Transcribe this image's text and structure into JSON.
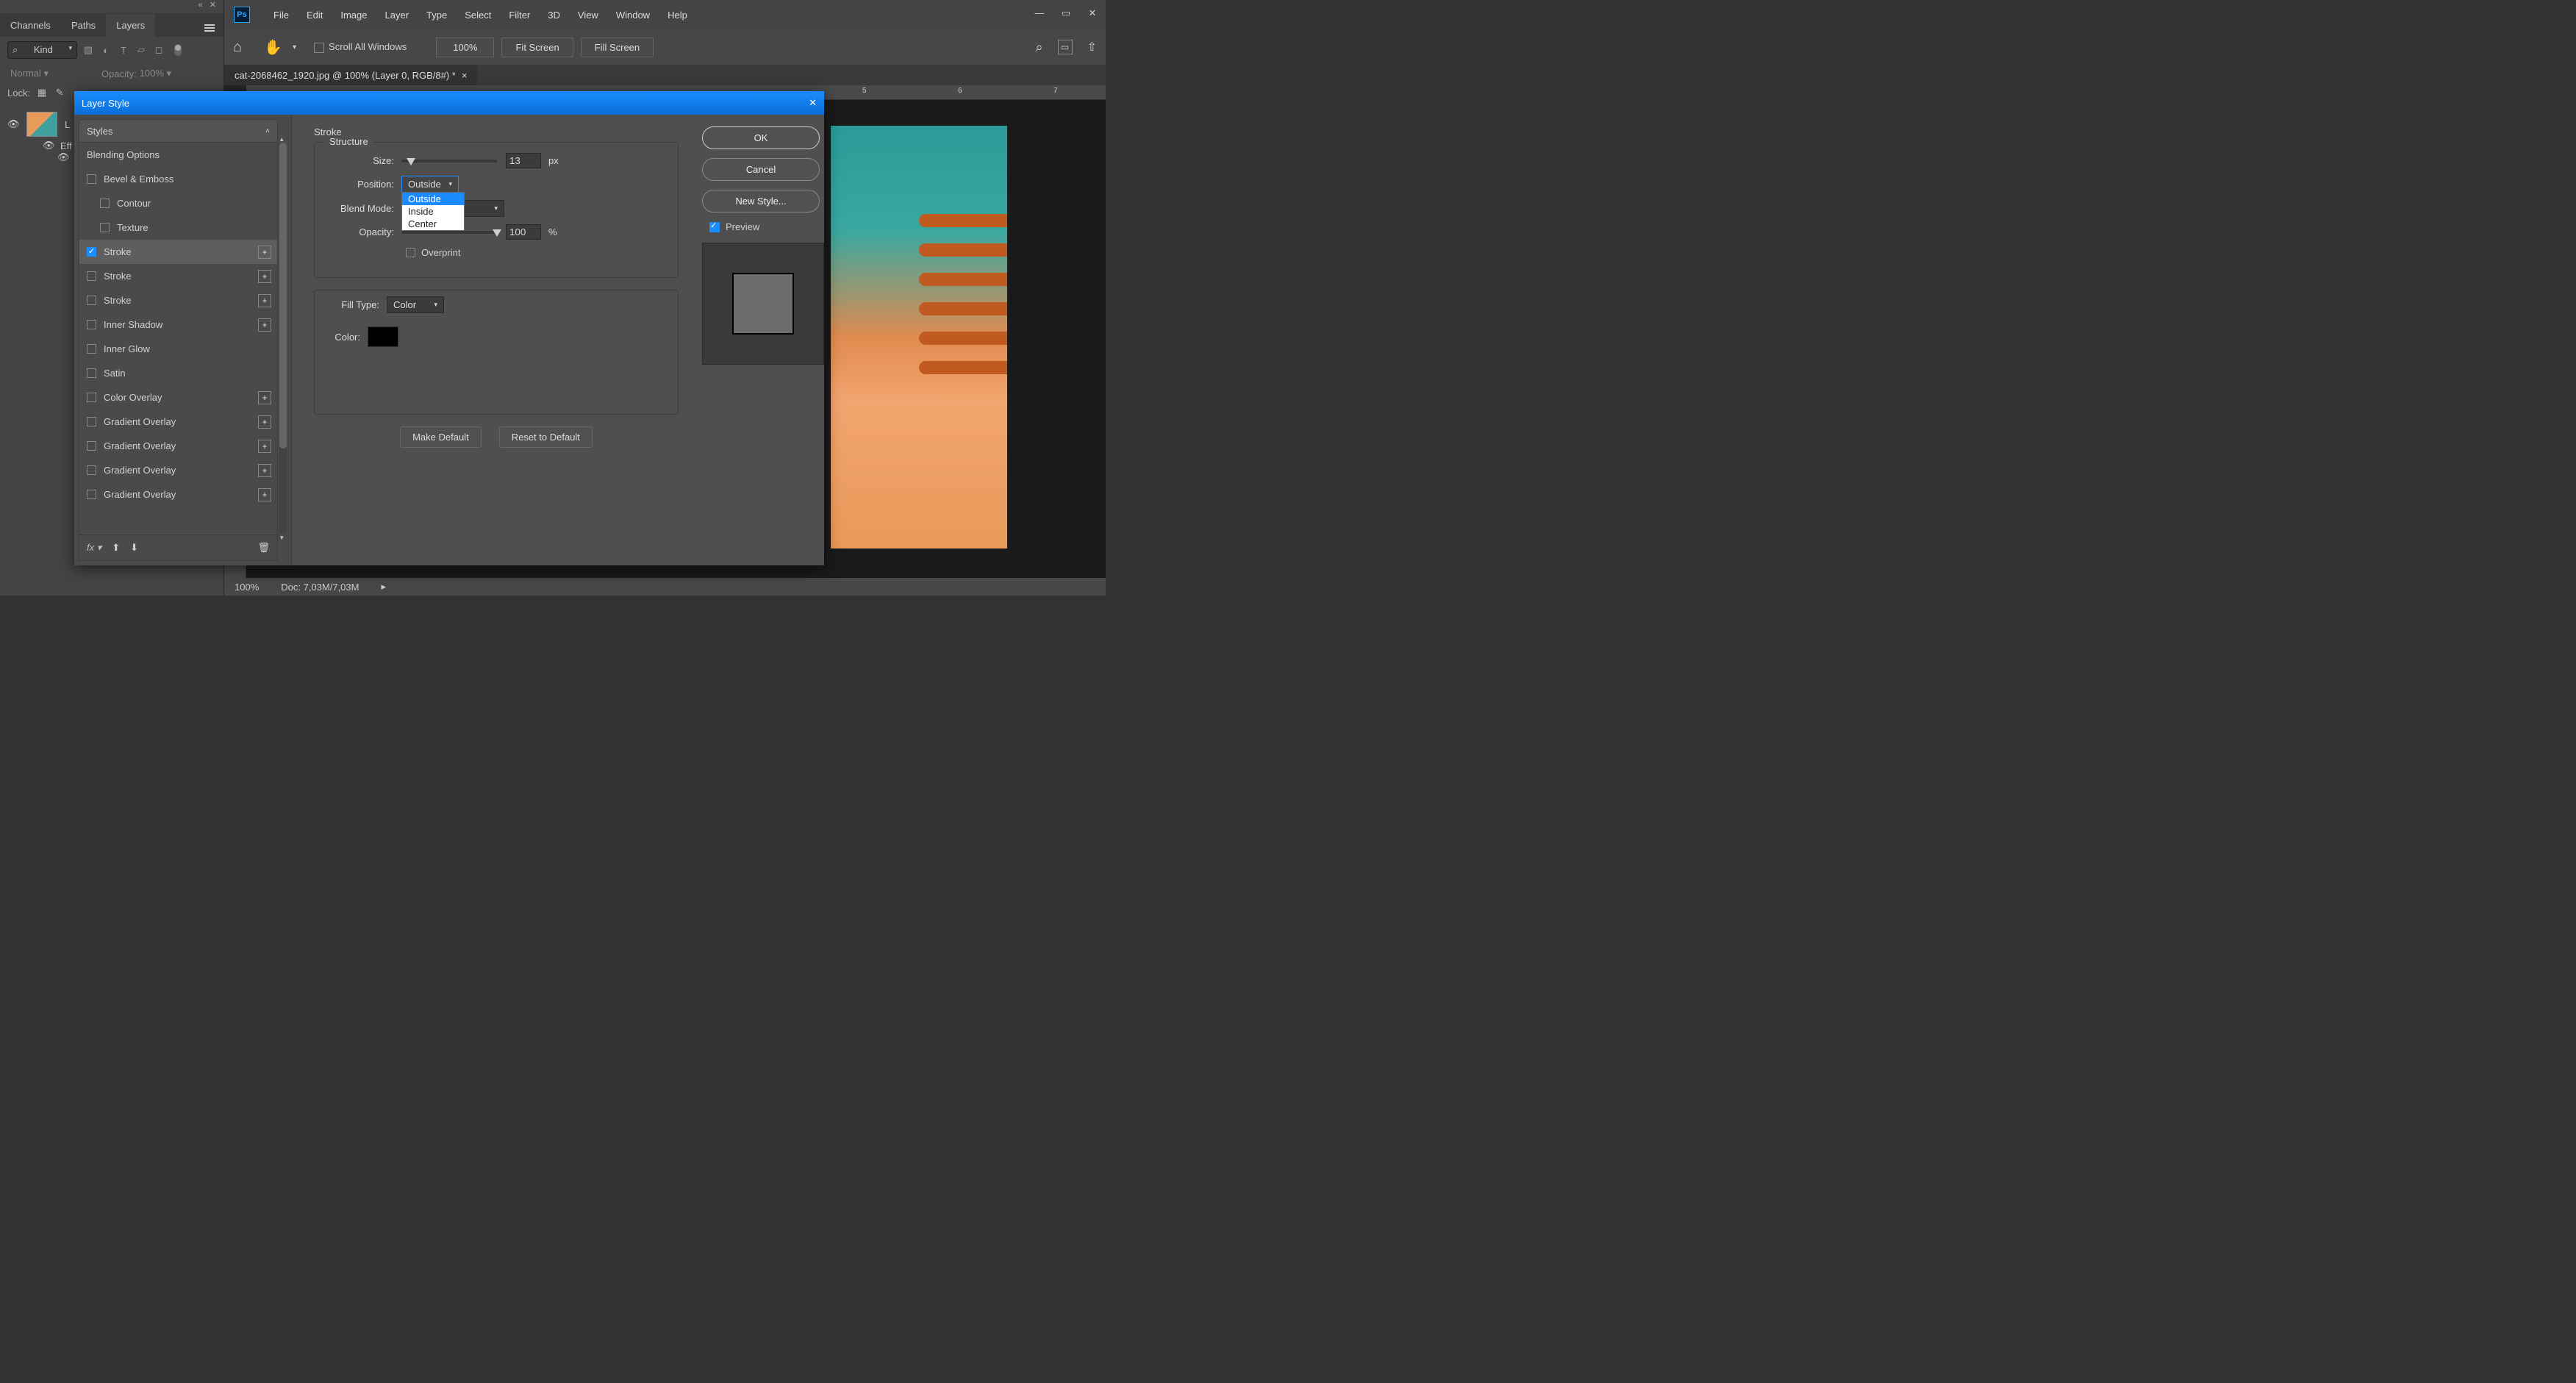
{
  "menu": {
    "items": [
      "File",
      "Edit",
      "Image",
      "Layer",
      "Type",
      "Select",
      "Filter",
      "3D",
      "View",
      "Window",
      "Help"
    ]
  },
  "panel": {
    "tabs": [
      "Channels",
      "Paths",
      "Layers"
    ],
    "kind_label": "Kind",
    "blend_label": "Normal",
    "opacity_label": "Opacity:",
    "opacity_value": "100%",
    "lock_label": "Lock:",
    "layer_name": "L",
    "effects_label": "Eff",
    "search_glyph": "⌕"
  },
  "options": {
    "scroll_all": "Scroll All Windows",
    "zoom": "100%",
    "fit": "Fit Screen",
    "fill": "Fill Screen"
  },
  "doc": {
    "tab": "cat-2068462_1920.jpg @ 100% (Layer 0, RGB/8#) *"
  },
  "ruler": {
    "marks": [
      "5",
      "6",
      "7"
    ]
  },
  "status": {
    "zoom": "100%",
    "doc": "Doc: 7,03M/7,03M"
  },
  "dialog": {
    "title": "Layer Style",
    "styles_header": "Styles",
    "blending": "Blending Options",
    "items": [
      {
        "label": "Bevel & Emboss",
        "checked": false,
        "plus": false,
        "child": false
      },
      {
        "label": "Contour",
        "checked": false,
        "plus": false,
        "child": true
      },
      {
        "label": "Texture",
        "checked": false,
        "plus": false,
        "child": true
      },
      {
        "label": "Stroke",
        "checked": true,
        "plus": true,
        "child": false,
        "selected": true
      },
      {
        "label": "Stroke",
        "checked": false,
        "plus": true,
        "child": false
      },
      {
        "label": "Stroke",
        "checked": false,
        "plus": true,
        "child": false
      },
      {
        "label": "Inner Shadow",
        "checked": false,
        "plus": true,
        "child": false
      },
      {
        "label": "Inner Glow",
        "checked": false,
        "plus": false,
        "child": false
      },
      {
        "label": "Satin",
        "checked": false,
        "plus": false,
        "child": false
      },
      {
        "label": "Color Overlay",
        "checked": false,
        "plus": true,
        "child": false
      },
      {
        "label": "Gradient Overlay",
        "checked": false,
        "plus": true,
        "child": false
      },
      {
        "label": "Gradient Overlay",
        "checked": false,
        "plus": true,
        "child": false
      },
      {
        "label": "Gradient Overlay",
        "checked": false,
        "plus": true,
        "child": false
      },
      {
        "label": "Gradient Overlay",
        "checked": false,
        "plus": true,
        "child": false
      }
    ],
    "fx_glyph": "fx",
    "stroke": {
      "title": "Stroke",
      "structure": "Structure",
      "size_label": "Size:",
      "size_value": "13",
      "size_unit": "px",
      "position_label": "Position:",
      "position_value": "Outside",
      "position_options": [
        "Outside",
        "Inside",
        "Center"
      ],
      "blend_label": "Blend Mode:",
      "opacity_label": "Opacity:",
      "opacity_value": "100",
      "opacity_unit": "%",
      "overprint_label": "Overprint",
      "fill_type_label": "Fill Type:",
      "fill_type_value": "Color",
      "color_label": "Color:",
      "make_default": "Make Default",
      "reset_default": "Reset to Default"
    },
    "buttons": {
      "ok": "OK",
      "cancel": "Cancel",
      "new_style": "New Style...",
      "preview": "Preview"
    }
  }
}
